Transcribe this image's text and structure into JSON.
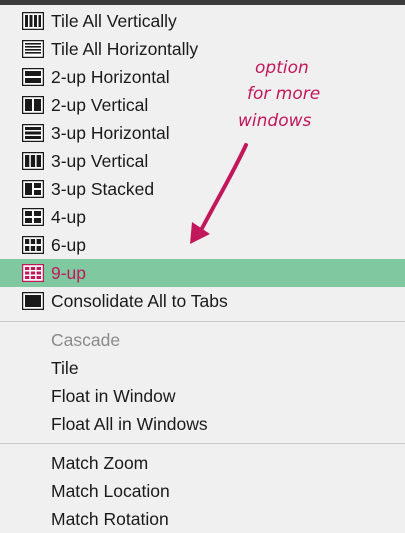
{
  "menu": {
    "items": [
      {
        "label": "Tile All Vertically",
        "icon": "tile-vertical-icon"
      },
      {
        "label": "Tile All Horizontally",
        "icon": "tile-horizontal-icon"
      },
      {
        "label": "2-up Horizontal",
        "icon": "two-up-horizontal-icon"
      },
      {
        "label": "2-up Vertical",
        "icon": "two-up-vertical-icon"
      },
      {
        "label": "3-up Horizontal",
        "icon": "three-up-horizontal-icon"
      },
      {
        "label": "3-up Vertical",
        "icon": "three-up-vertical-icon"
      },
      {
        "label": "3-up Stacked",
        "icon": "three-up-stacked-icon"
      },
      {
        "label": "4-up",
        "icon": "four-up-icon"
      },
      {
        "label": "6-up",
        "icon": "six-up-icon"
      },
      {
        "label": "9-up",
        "icon": "nine-up-icon",
        "highlighted": true
      },
      {
        "label": "Consolidate All to Tabs",
        "icon": "consolidate-tabs-icon"
      },
      {
        "label": "Cascade",
        "disabled": true
      },
      {
        "label": "Tile"
      },
      {
        "label": "Float in Window"
      },
      {
        "label": "Float All in Windows"
      },
      {
        "label": "Match Zoom"
      },
      {
        "label": "Match Location"
      },
      {
        "label": "Match Rotation"
      }
    ]
  },
  "annotation": {
    "text_lines": [
      "option",
      "for more",
      "windows"
    ],
    "color": "#c2185b"
  },
  "colors": {
    "highlight_bg": "#7fc8a0",
    "highlight_text": "#c2185b",
    "disabled_text": "#8a8a8a",
    "menu_bg": "#f0f0f0"
  }
}
